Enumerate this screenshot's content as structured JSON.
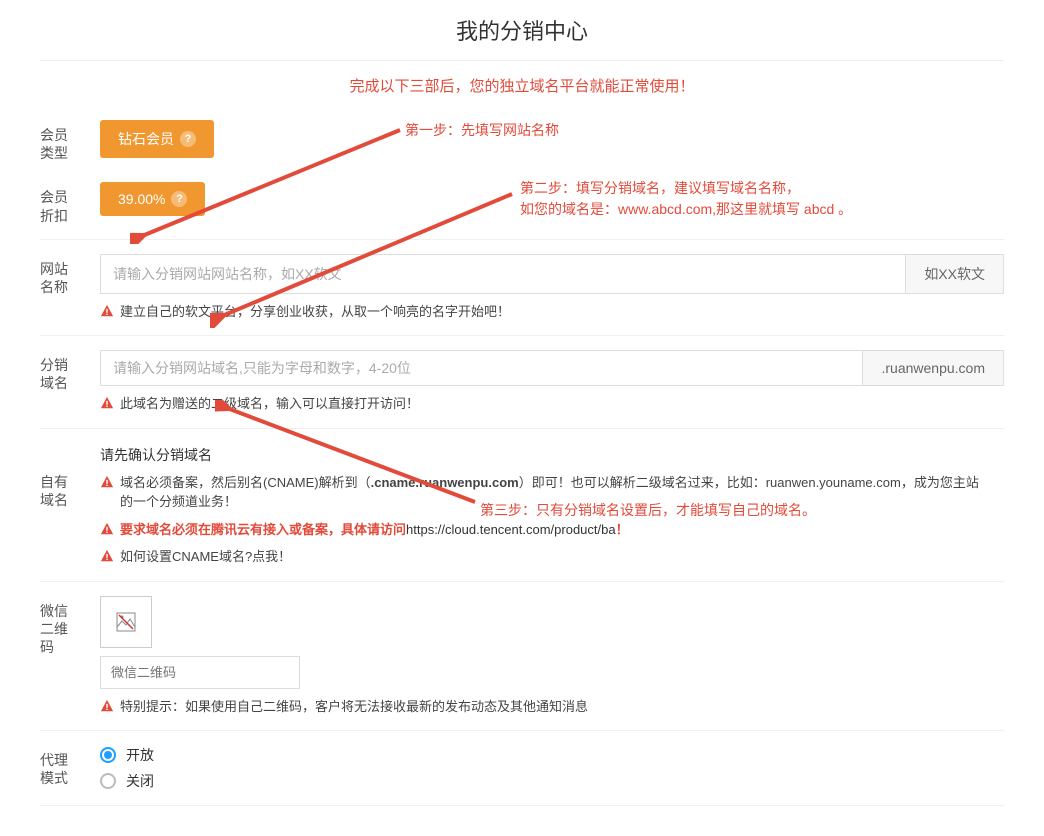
{
  "title": "我的分销中心",
  "instr_header": "完成以下三部后，您的独立域名平台就能正常使用！",
  "colors": {
    "accent": "#f1972f",
    "danger": "#e24a3a",
    "primary": "#1e9fff"
  },
  "member_type": {
    "label": "会员\n类型",
    "badge": "钻石会员"
  },
  "discount": {
    "label": "会员\n折扣",
    "value": "39.00%"
  },
  "site_name": {
    "label": "网站\n名称",
    "placeholder": "请输入分销网站网站名称，如XX软文",
    "addon": "如XX软文",
    "hint": "建立自己的软文平台，分享创业收获，从取一个响亮的名字开始吧！"
  },
  "dist_domain": {
    "label": "分销\n域名",
    "placeholder": "请输入分销网站域名,只能为字母和数字，4-20位",
    "addon": ".ruanwenpu.com",
    "hint": "此域名为赠送的二级域名，输入可以直接打开访问！"
  },
  "own_domain": {
    "label": "自有\n域名",
    "heading": "请先确认分销域名",
    "line1_pre": "域名必须备案，然后别名(CNAME)解析到（",
    "line1_bold": ".cname.ruanwenpu.com",
    "line1_post": "）即可！也可以解析二级域名过来，比如：ruanwen.youname.com，成为您主站的一个分频道业务！",
    "line2_pre": "要求域名必须在腾讯云有接入或备案，具体请访问",
    "line2_url": "https://cloud.tencent.com/product/ba",
    "line2_post": "！",
    "line3": "如何设置CNAME域名?点我！"
  },
  "qr": {
    "label": "微信\n二维\n码",
    "placeholder": "微信二维码",
    "hint": "特别提示：如果使用自己二维码，客户将无法接收最新的发布动态及其他通知消息"
  },
  "mode": {
    "label": "代理\n模式",
    "open": "开放",
    "close": "关闭",
    "selected": "open"
  },
  "steps": {
    "s1": "第一步：先填写网站名称",
    "s2a": "第二步：填写分销域名，建议填写域名名称，",
    "s2b": "如您的域名是：www.abcd.com,那这里就填写 abcd 。",
    "s3": "第三步：只有分销域名设置后，才能填写自己的域名。"
  }
}
